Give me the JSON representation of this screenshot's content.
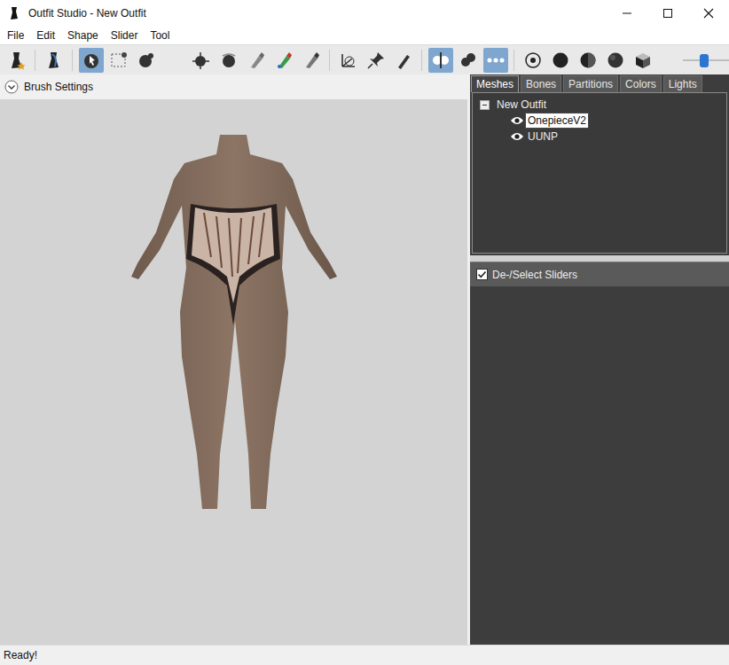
{
  "window": {
    "title": "Outfit Studio - New Outfit"
  },
  "menu": [
    "File",
    "Edit",
    "Shape",
    "Slider",
    "Tool"
  ],
  "toolbar": {
    "tools": [
      {
        "kind": "lognew",
        "selected": false
      },
      {
        "kind": "sep",
        "selected": false
      },
      {
        "kind": "logo",
        "selected": false
      },
      {
        "kind": "sep",
        "selected": false
      },
      {
        "kind": "select",
        "selected": true
      },
      {
        "kind": "mask",
        "selected": false
      },
      {
        "kind": "inflate",
        "selected": false
      },
      {
        "kind": "deflate",
        "selected": false
      },
      {
        "kind": "move",
        "selected": false
      },
      {
        "kind": "smooth",
        "selected": false
      },
      {
        "kind": "undiff",
        "selected": false
      },
      {
        "kind": "color",
        "selected": false
      },
      {
        "kind": "alpha",
        "selected": false
      },
      {
        "kind": "sep",
        "selected": false
      },
      {
        "kind": "transform",
        "selected": false
      },
      {
        "kind": "pin",
        "selected": false
      },
      {
        "kind": "pencil",
        "selected": false
      },
      {
        "kind": "sep",
        "selected": false
      },
      {
        "kind": "mirror",
        "selected": true
      },
      {
        "kind": "connected",
        "selected": false
      },
      {
        "kind": "xray",
        "selected": true
      },
      {
        "kind": "sep",
        "selected": false
      },
      {
        "kind": "ring",
        "selected": false
      },
      {
        "kind": "solid",
        "selected": false
      },
      {
        "kind": "half",
        "selected": false
      },
      {
        "kind": "shaded",
        "selected": false
      },
      {
        "kind": "cube",
        "selected": false
      }
    ],
    "brush_size": {
      "level": 0.46
    }
  },
  "brush_settings": {
    "label": "Brush Settings",
    "expanded": false
  },
  "tabs": [
    {
      "label": "Meshes",
      "selected": true
    },
    {
      "label": "Bones",
      "selected": false
    },
    {
      "label": "Partitions",
      "selected": false
    },
    {
      "label": "Colors",
      "selected": false
    },
    {
      "label": "Lights",
      "selected": false
    }
  ],
  "tree": {
    "root": {
      "label": "New Outfit",
      "expanded": true
    },
    "items": [
      {
        "label": "OnepieceV2",
        "visible": true,
        "selected": true
      },
      {
        "label": "UUNP",
        "visible": true,
        "selected": false
      }
    ]
  },
  "sliders_header": {
    "label": "De-/Select Sliders",
    "checked": true
  },
  "status_bar": "Ready!"
}
